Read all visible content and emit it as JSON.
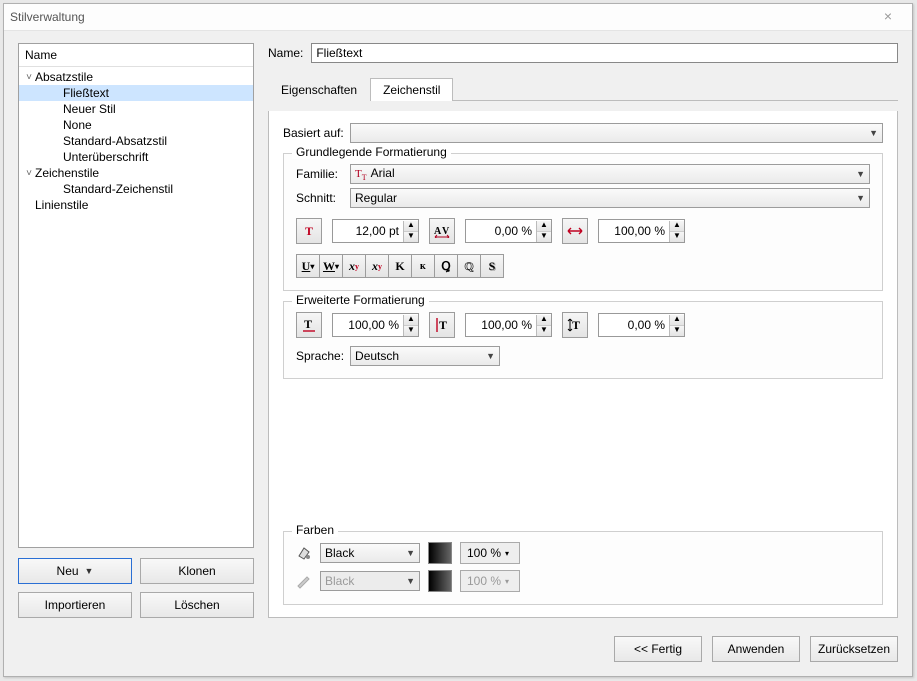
{
  "window_title": "Stilverwaltung",
  "left": {
    "header": "Name",
    "tree": [
      {
        "label": "Absatzstile",
        "expandable": true,
        "open": true,
        "depth": 0
      },
      {
        "label": "Fließtext",
        "depth": 2,
        "selected": true
      },
      {
        "label": "Neuer Stil",
        "depth": 2
      },
      {
        "label": "None",
        "depth": 2
      },
      {
        "label": "Standard-Absatzstil",
        "depth": 2
      },
      {
        "label": "Unterüberschrift",
        "depth": 2
      },
      {
        "label": "Zeichenstile",
        "expandable": true,
        "open": true,
        "depth": 0
      },
      {
        "label": "Standard-Zeichenstil",
        "depth": 2
      },
      {
        "label": "Linienstile",
        "depth": 0
      }
    ],
    "buttons": {
      "new": "Neu",
      "clone": "Klonen",
      "import": "Importieren",
      "delete": "Löschen"
    }
  },
  "right": {
    "name_label": "Name:",
    "name_value": "Fließtext",
    "tabs": [
      "Eigenschaften",
      "Zeichenstil"
    ],
    "active_tab": 1,
    "based_on_label": "Basiert auf:",
    "based_on_value": "",
    "group1": {
      "legend": "Grundlegende Formatierung",
      "family_label": "Familie:",
      "family_value": "Arial",
      "cut_label": "Schnitt:",
      "cut_value": "Regular",
      "size": "12,00 pt",
      "tracking": "0,00 %",
      "hscale": "100,00 %"
    },
    "group2": {
      "legend": "Erweiterte Formatierung",
      "a": "100,00 %",
      "b": "100,00 %",
      "c": "0,00 %",
      "lang_label": "Sprache:",
      "lang_value": "Deutsch"
    },
    "group3": {
      "legend": "Farben",
      "fill_color": "Black",
      "fill_pct": "100 %",
      "stroke_color": "Black",
      "stroke_pct": "100 %"
    }
  },
  "footer": {
    "done": "<< Fertig",
    "apply": "Anwenden",
    "reset": "Zurücksetzen"
  }
}
